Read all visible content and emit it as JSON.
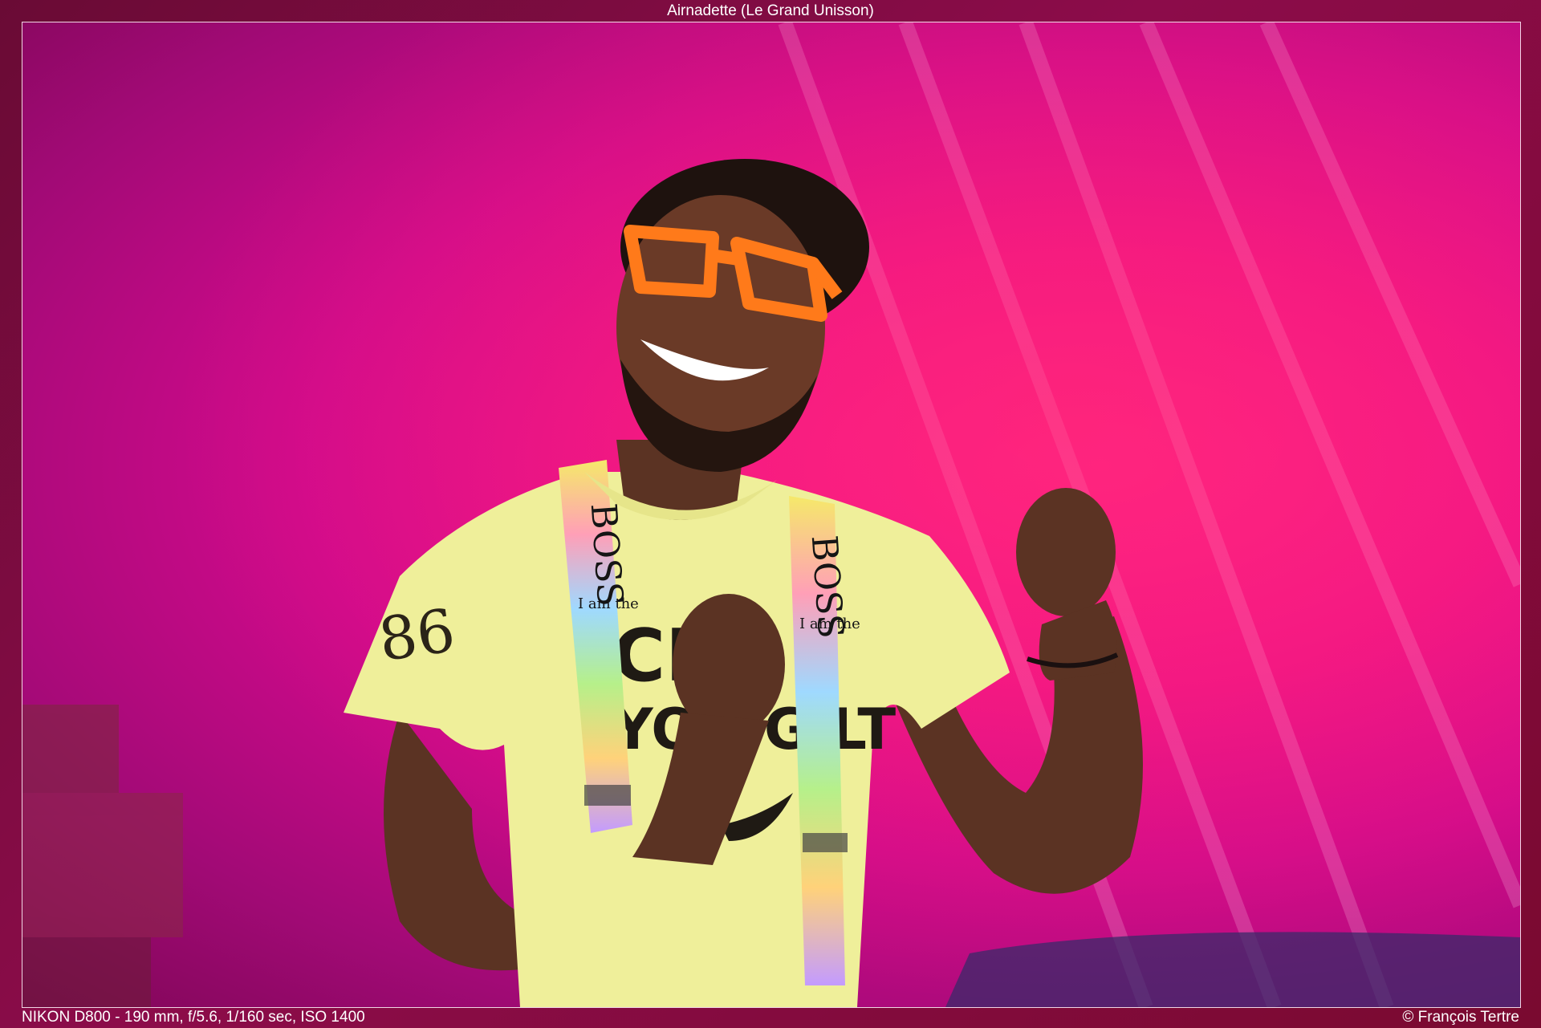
{
  "title": "Airnadette (Le Grand Unisson)",
  "exif": "NIKON D800 - 190 mm, f/5.6, 1/160 sec, ISO 1400",
  "copyright": "© François Tertre",
  "shirt": {
    "sleeve_number": "86",
    "front_line1": "CRA",
    "front_line2": "YOU GILT"
  },
  "suspenders": {
    "left_big": "BOSS",
    "left_small": "I am the",
    "right_big": "BOSS",
    "right_small": "I am the"
  },
  "colors": {
    "backdrop": "#e5127f",
    "shirt": "#efef9a",
    "glasses": "#ff7a1a",
    "skin": "#5b3323"
  }
}
